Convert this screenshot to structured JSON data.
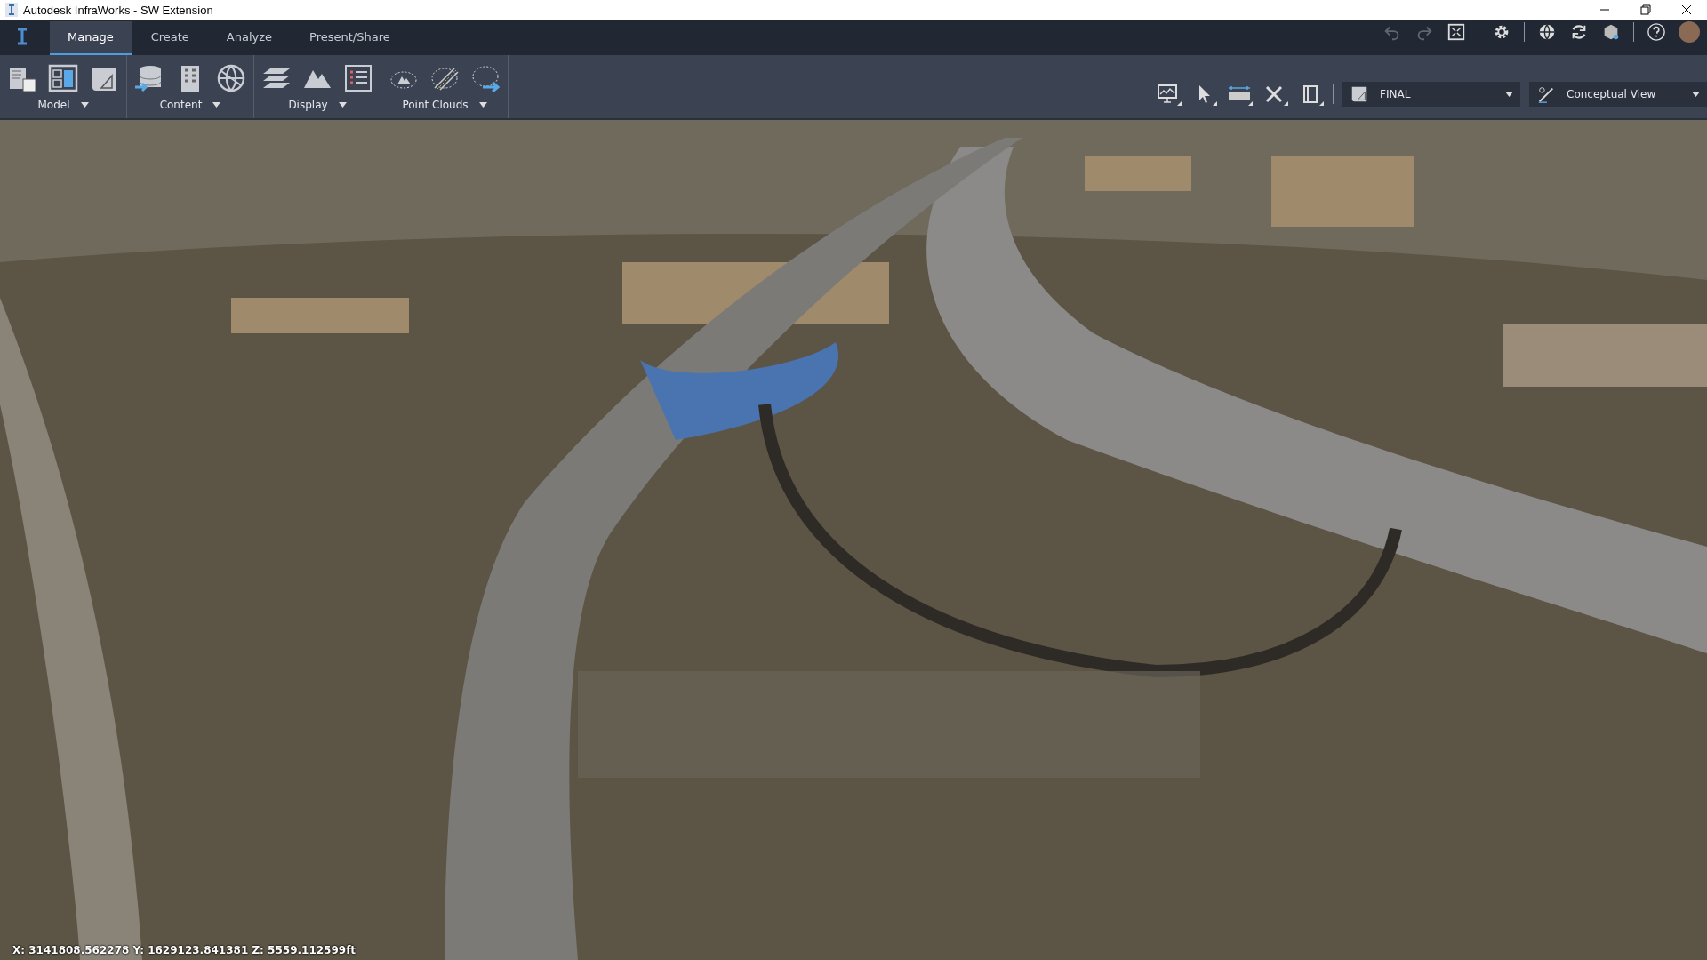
{
  "window": {
    "title": "Autodesk InfraWorks - SW Extension"
  },
  "tabs": [
    {
      "label": "Manage",
      "selected": true
    },
    {
      "label": "Create",
      "selected": false
    },
    {
      "label": "Analyze",
      "selected": false
    },
    {
      "label": "Present/Share",
      "selected": false
    }
  ],
  "ribbon_panels": [
    {
      "label": "Model"
    },
    {
      "label": "Content"
    },
    {
      "label": "Display"
    },
    {
      "label": "Point Clouds"
    }
  ],
  "proposal_dropdown": {
    "value": "FINAL"
  },
  "style_dropdown": {
    "value": "Conceptual View"
  },
  "status": {
    "coordinates": "X: 3141808.562278 Y: 1629123.841381 Z: 5559.112599ft"
  }
}
